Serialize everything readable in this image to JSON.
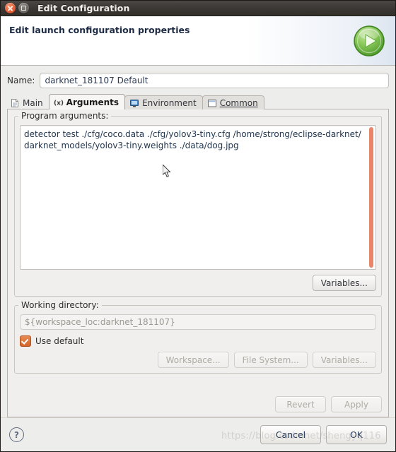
{
  "window": {
    "title": "Edit Configuration",
    "close_icon": "close-icon",
    "maximize_icon": "maximize-icon"
  },
  "banner": {
    "title": "Edit launch configuration properties",
    "icon": "run-play-icon"
  },
  "name_field": {
    "label": "Name:",
    "value": "darknet_181107 Default"
  },
  "tabs": [
    {
      "label": "Main",
      "icon": "document-icon",
      "active": false
    },
    {
      "label": "Arguments",
      "icon": "variable-icon",
      "active": true
    },
    {
      "label": "Environment",
      "icon": "monitor-icon",
      "active": false
    },
    {
      "label": "Common",
      "icon": "window-icon",
      "active": false
    }
  ],
  "program_arguments": {
    "group_label": "Program arguments:",
    "value": "detector test ./cfg/coco.data ./cfg/yolov3-tiny.cfg /home/strong/eclipse-darknet/darknet_models/yolov3-tiny.weights ./data/dog.jpg",
    "variables_button": "Variables..."
  },
  "working_directory": {
    "group_label": "Working directory:",
    "value": "${workspace_loc:darknet_181107}",
    "use_default_label": "Use default",
    "use_default_checked": true,
    "buttons": [
      {
        "label": "Workspace...",
        "disabled": true
      },
      {
        "label": "File System...",
        "disabled": true
      },
      {
        "label": "Variables...",
        "disabled": true
      }
    ]
  },
  "action_buttons": {
    "revert": "Revert",
    "apply": "Apply",
    "revert_disabled": true,
    "apply_disabled": true
  },
  "footer": {
    "help_icon": "help-icon",
    "help_glyph": "?",
    "cancel": "Cancel",
    "ok": "OK",
    "watermark": "https://blog.csdn.net/shengyq116"
  },
  "colors": {
    "accent_orange": "#d4642a",
    "run_green": "#6cb33f",
    "dialog_bg": "#ededeb",
    "scrollbar_thumb": "#e8866a",
    "title_bar": "#3b3734"
  }
}
